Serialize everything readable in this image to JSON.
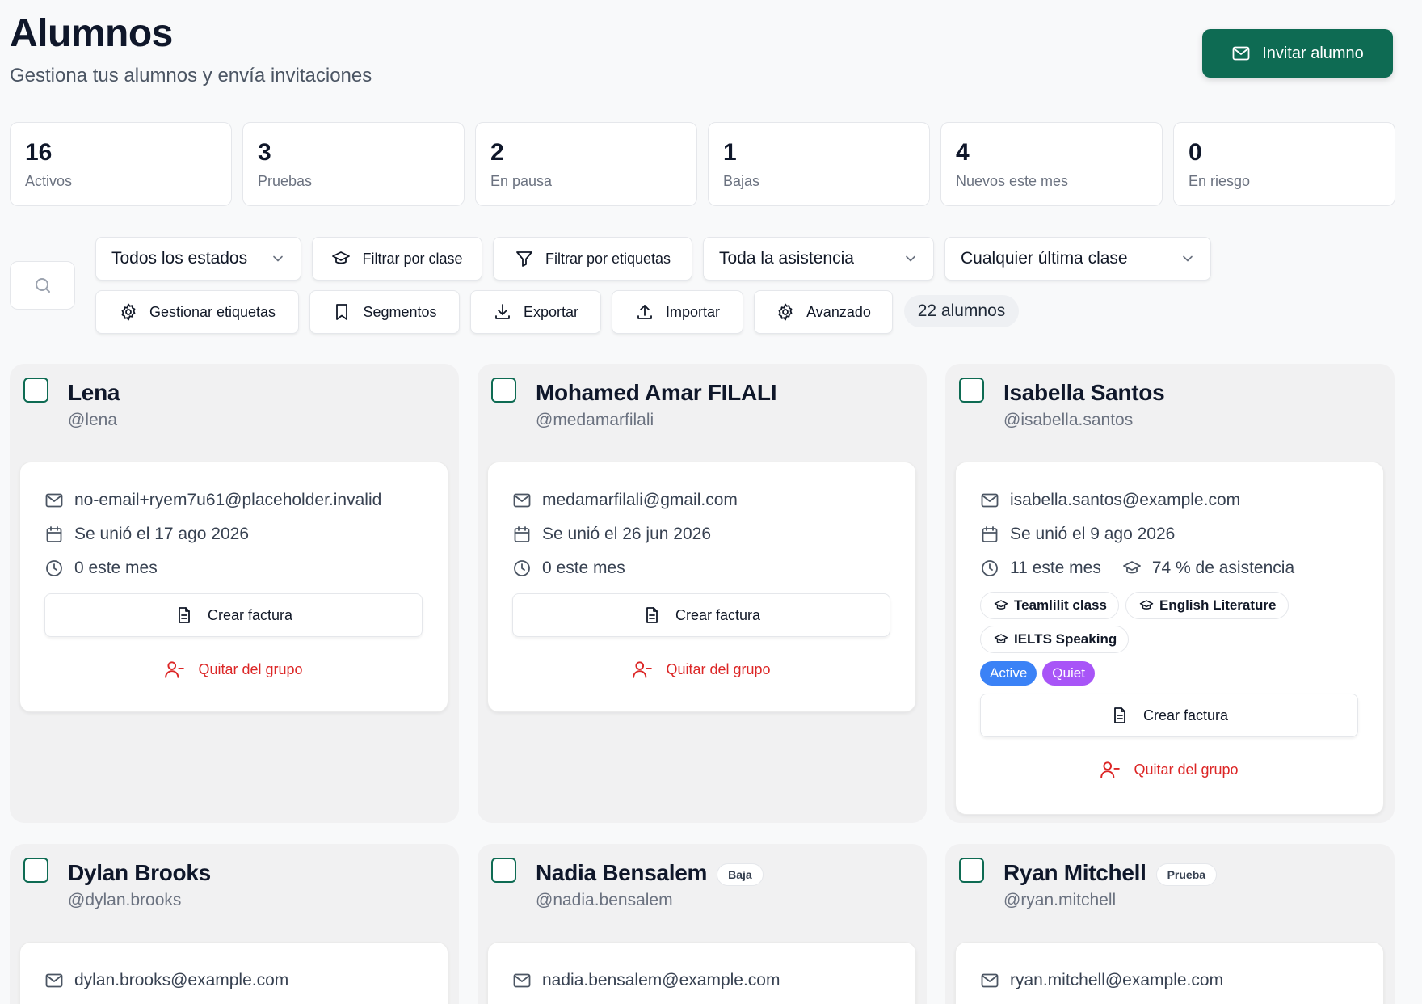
{
  "header": {
    "title": "Alumnos",
    "subtitle": "Gestiona tus alumnos y envía invitaciones",
    "invite_label": "Invitar alumno"
  },
  "stats": [
    {
      "value": "16",
      "label": "Activos"
    },
    {
      "value": "3",
      "label": "Pruebas"
    },
    {
      "value": "2",
      "label": "En pausa"
    },
    {
      "value": "1",
      "label": "Bajas"
    },
    {
      "value": "4",
      "label": "Nuevos este mes"
    },
    {
      "value": "0",
      "label": "En riesgo"
    }
  ],
  "filters": {
    "status": "Todos los estados",
    "by_class": "Filtrar por clase",
    "by_tags": "Filtrar por etiquetas",
    "attendance": "Toda la asistencia",
    "last_class": "Cualquier última clase",
    "manage_tags": "Gestionar etiquetas",
    "segments": "Segmentos",
    "export": "Exportar",
    "import": "Importar",
    "advanced": "Avanzado",
    "count": "22 alumnos"
  },
  "actions": {
    "invoice": "Crear factura",
    "remove": "Quitar del grupo"
  },
  "students": [
    {
      "name": "Lena",
      "handle": "@lena",
      "email": "no-email+ryem7u61@placeholder.invalid",
      "joined": "Se unió el 17 ago 2026",
      "sessions": "0 este mes"
    },
    {
      "name": "Mohamed Amar FILALI",
      "handle": "@medamarfilali",
      "email": "medamarfilali@gmail.com",
      "joined": "Se unió el 26 jun 2026",
      "sessions": "0 este mes"
    },
    {
      "name": "Isabella Santos",
      "handle": "@isabella.santos",
      "email": "isabella.santos@example.com",
      "joined": "Se unió el 9 ago 2026",
      "sessions": "11 este mes",
      "attendance": "74 % de asistencia",
      "classes": [
        "Teamlilit class",
        "English Literature",
        "IELTS Speaking"
      ],
      "tags": [
        {
          "label": "Active",
          "color": "#3b82f6"
        },
        {
          "label": "Quiet",
          "color": "#a855f7"
        }
      ]
    },
    {
      "name": "Dylan Brooks",
      "handle": "@dylan.brooks",
      "email": "dylan.brooks@example.com"
    },
    {
      "name": "Nadia Bensalem",
      "badge": "Baja",
      "handle": "@nadia.bensalem",
      "email": "nadia.bensalem@example.com"
    },
    {
      "name": "Ryan Mitchell",
      "badge": "Prueba",
      "handle": "@ryan.mitchell",
      "email": "ryan.mitchell@example.com"
    }
  ],
  "colors": {
    "accent": "#0e6b53",
    "danger": "#dc2626"
  }
}
